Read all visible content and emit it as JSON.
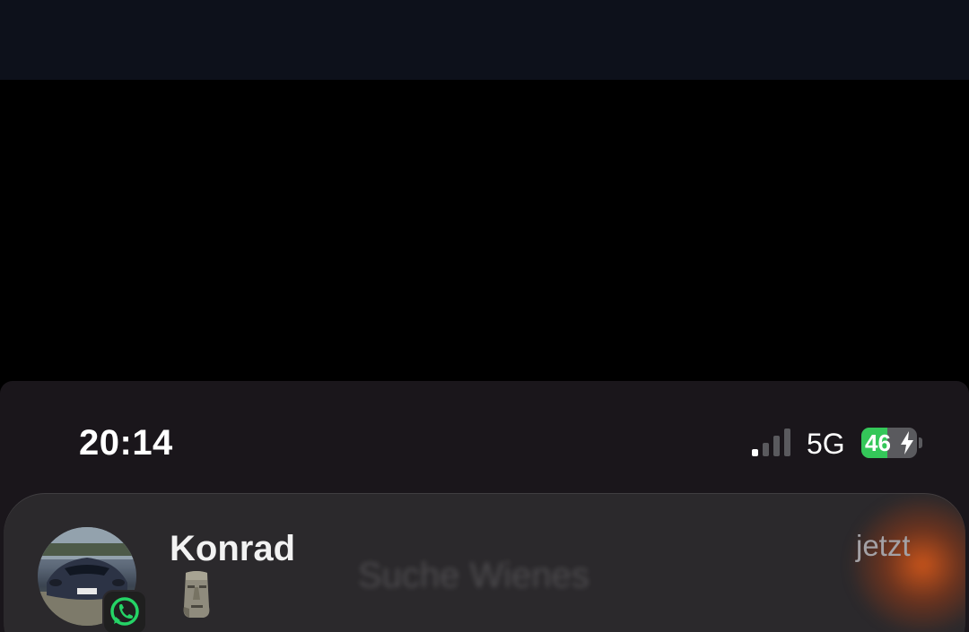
{
  "status_bar": {
    "time": "20:14",
    "network": "5G",
    "battery_level": 46,
    "battery_text": "46",
    "signal_bars_active": 1,
    "signal_bars_total": 4,
    "charging": true
  },
  "notification": {
    "app": "WhatsApp",
    "sender": "Konrad",
    "time": "jetzt",
    "message_icon": "moai-emoji-icon",
    "background_text": "Suche Wienes"
  },
  "colors": {
    "battery_fill": "#34c759",
    "whatsapp_green": "#25d366",
    "accent_glow": "#dc5a19"
  }
}
